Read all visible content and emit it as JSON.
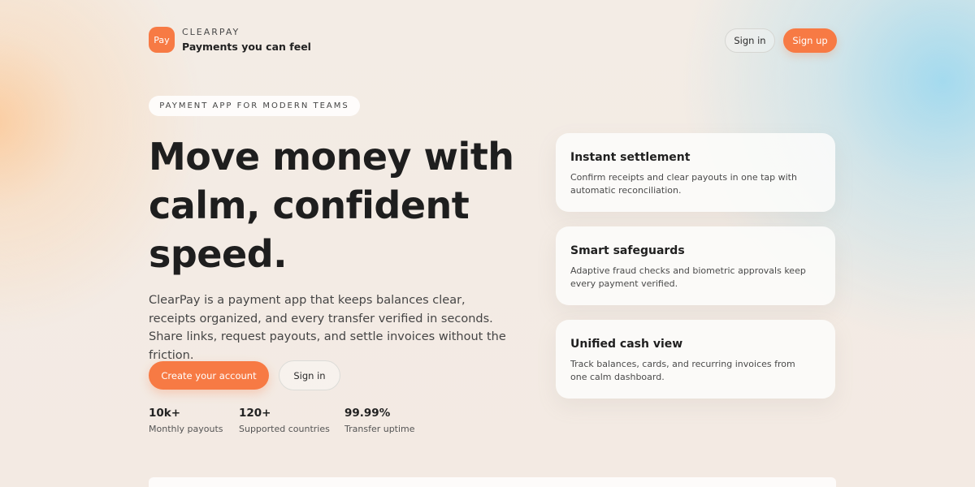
{
  "header": {
    "logo_text": "Pay",
    "brand_name": "CLEARPAY",
    "tagline": "Payments you can feel",
    "sign_in_label": "Sign in",
    "sign_up_label": "Sign up"
  },
  "hero": {
    "pill": "PAYMENT APP FOR MODERN TEAMS",
    "title_lines": [
      "Move money with",
      "calm, confident",
      "speed."
    ],
    "body": "ClearPay is a payment app that keeps balances clear, receipts organized, and every transfer verified in seconds. Share links, request payouts, and settle invoices without the friction.",
    "cta_primary": "Create your account",
    "cta_secondary": "Sign in"
  },
  "stats": [
    {
      "value": "10k+",
      "label": "Monthly payouts"
    },
    {
      "value": "120+",
      "label": "Supported countries"
    },
    {
      "value": "99.99%",
      "label": "Transfer uptime"
    }
  ],
  "features": [
    {
      "title": "Instant settlement",
      "description": "Confirm receipts and clear payouts in one tap with automatic reconciliation."
    },
    {
      "title": "Smart safeguards",
      "description": "Adaptive fraud checks and biometric approvals keep every payment verified."
    },
    {
      "title": "Unified cash view",
      "description": "Track balances, cards, and recurring invoices from one calm dashboard."
    }
  ],
  "colors": {
    "accent": "#f77a44",
    "text": "#1e1e1e"
  }
}
